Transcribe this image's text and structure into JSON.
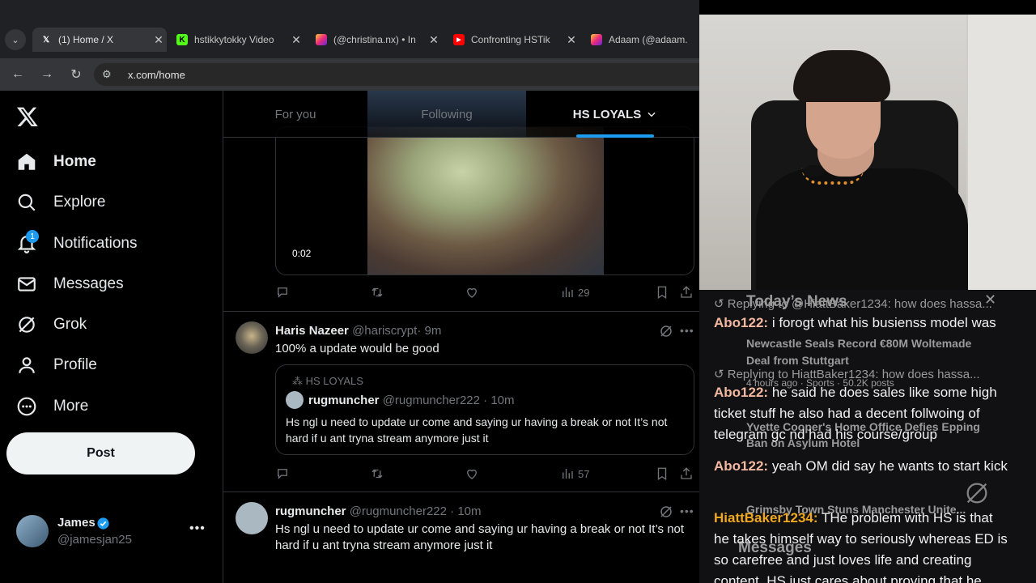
{
  "browser": {
    "tabs": [
      {
        "title": "(1) Home / X",
        "favicon": "x-logo-icon",
        "active": true
      },
      {
        "title": "hstikkytokky Video",
        "favicon": "kick-icon",
        "active": false
      },
      {
        "title": "(@christina.nx) • In",
        "favicon": "instagram-icon",
        "active": false
      },
      {
        "title": "Confronting HSTik",
        "favicon": "youtube-icon",
        "active": false
      },
      {
        "title": "Adaam (@adaam.",
        "favicon": "instagram-icon",
        "active": false
      }
    ],
    "url": "x.com/home"
  },
  "sidebar": {
    "items": [
      {
        "label": "Home",
        "icon": "home-icon",
        "active": true
      },
      {
        "label": "Explore",
        "icon": "search-icon"
      },
      {
        "label": "Notifications",
        "icon": "bell-icon",
        "badge": "1"
      },
      {
        "label": "Messages",
        "icon": "mail-icon"
      },
      {
        "label": "Grok",
        "icon": "grok-icon"
      },
      {
        "label": "Profile",
        "icon": "person-icon"
      },
      {
        "label": "More",
        "icon": "more-circle-icon"
      }
    ],
    "post_label": "Post",
    "account": {
      "name": "James",
      "handle": "@jamesjan25"
    }
  },
  "timeline": {
    "tabs": [
      "For you",
      "Following",
      "HS LOYALS"
    ],
    "active_tab": "HS LOYALS",
    "video_post": {
      "duration": "0:02",
      "views": "29"
    },
    "posts": [
      {
        "name": "Haris Nazeer",
        "handle": "@hariscrypt",
        "time": "· 9m",
        "text": "100% a update would be good",
        "quote": {
          "community": "HS LOYALS",
          "name": "rugmuncher",
          "handle": "@rugmuncher222",
          "time": "· 10m",
          "text": "Hs ngl u need to update ur come and saying ur having a break or not    It’s not hard if u ant tryna stream anymore just it"
        },
        "views": "57"
      },
      {
        "name": "rugmuncher",
        "handle": "@rugmuncher222",
        "time": "· 10m",
        "text": "Hs ngl u need to update ur come and saying ur having a break or not    It’s not hard if u ant tryna stream anymore just it"
      }
    ]
  },
  "chat": {
    "ghost_overlay": [
      "Today’s News",
      "Newcastle Seals Record €80M Woltemade",
      "Deal from Stuttgart",
      "4 hours ago · Sports · 50.2K posts",
      "Yvette Cooper's Home Office Defies Epping",
      "Ban on Asylum Hotel",
      "Grimsby Town Stuns Manchester Unite...",
      "Messages"
    ],
    "messages": [
      {
        "reply": "Replying to @HiattBaker1234: how does hassa...",
        "user": "Abo122",
        "color": "#f2b8a0",
        "text": "i forogt what his busienss model was"
      },
      {
        "reply": "Replying to HiattBaker1234: how does hassa...",
        "user": "Abo122",
        "color": "#f2b8a0",
        "text": "he said he does sales like some high ticket stuff he also had a decent follwoing of telegram gc nd had his course/group"
      },
      {
        "user": "Abo122",
        "color": "#f2b8a0",
        "text": "yeah OM did say he wants to start kick"
      },
      {
        "user": "HiattBaker1234",
        "color": "#f0a820",
        "text": "THe problem with HS is that he takes himself way to seriously whereas ED is so carefree and just loves life and creating content. HS just cares about proving that he"
      }
    ]
  }
}
